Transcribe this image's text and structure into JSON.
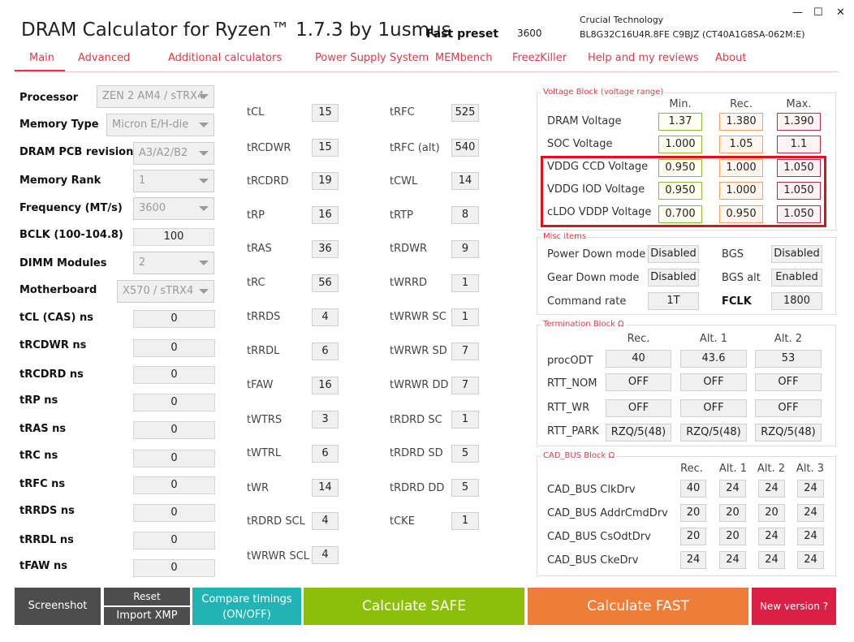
{
  "title": "DRAM Calculator for Ryzen™ 1.7.3 by 1usmus",
  "preset": "Fast preset",
  "frequency_top": "3600",
  "memory": {
    "maker": "Crucial Technology",
    "part": "BL8G32C16U4R.8FE  C9BJZ (CT40A1G8SA-062M:E)"
  },
  "window": {
    "minimize": "—",
    "maximize": "☐",
    "close": "✕"
  },
  "nav": [
    "Main",
    "Advanced",
    "Additional calculators",
    "Power Supply System",
    "MEMbench",
    "FreezKiller",
    "Help and my reviews",
    "About"
  ],
  "left": {
    "processor": {
      "label": "Processor",
      "value": "ZEN 2 AM4 / sTRX4"
    },
    "memory_type": {
      "label": "Memory Type",
      "value": "Micron E/H-die"
    },
    "pcb": {
      "label": "DRAM PCB revision",
      "value": "A3/A2/B2"
    },
    "rank": {
      "label": "Memory Rank",
      "value": "1"
    },
    "frequency": {
      "label": "Frequency (MT/s)",
      "value": "3600"
    },
    "bclk": {
      "label": "BCLK (100-104.8)",
      "value": "100"
    },
    "dimm": {
      "label": "DIMM Modules",
      "value": "2"
    },
    "motherboard": {
      "label": "Motherboard",
      "value": "X570 / sTRX4"
    },
    "ns": [
      {
        "label": "tCL (CAS) ns",
        "value": "0"
      },
      {
        "label": "tRCDWR ns",
        "value": "0"
      },
      {
        "label": "tRCDRD ns",
        "value": "0"
      },
      {
        "label": "tRP ns",
        "value": "0"
      },
      {
        "label": "tRAS ns",
        "value": "0"
      },
      {
        "label": "tRC ns",
        "value": "0"
      },
      {
        "label": "tRFC ns",
        "value": "0"
      },
      {
        "label": "tRRDS ns",
        "value": "0"
      },
      {
        "label": "tRRDL ns",
        "value": "0"
      },
      {
        "label": "tFAW ns",
        "value": "0"
      }
    ]
  },
  "timings_left": [
    {
      "label": "tCL",
      "value": "15"
    },
    {
      "label": "tRCDWR",
      "value": "15"
    },
    {
      "label": "tRCDRD",
      "value": "19"
    },
    {
      "label": "tRP",
      "value": "16"
    },
    {
      "label": "tRAS",
      "value": "36"
    },
    {
      "label": "tRC",
      "value": "56"
    },
    {
      "label": "tRRDS",
      "value": "4"
    },
    {
      "label": "tRRDL",
      "value": "6"
    },
    {
      "label": "tFAW",
      "value": "16"
    },
    {
      "label": "tWTRS",
      "value": "3"
    },
    {
      "label": "tWTRL",
      "value": "6"
    },
    {
      "label": "tWR",
      "value": "14"
    },
    {
      "label": "tRDRD SCL",
      "value": "4"
    },
    {
      "label": "tWRWR SCL",
      "value": "4"
    }
  ],
  "timings_right": [
    {
      "label": "tRFC",
      "value": "525"
    },
    {
      "label": "tRFC (alt)",
      "value": "540"
    },
    {
      "label": "tCWL",
      "value": "14"
    },
    {
      "label": "tRTP",
      "value": "8"
    },
    {
      "label": "tRDWR",
      "value": "9"
    },
    {
      "label": "tWRRD",
      "value": "1"
    },
    {
      "label": "tWRWR SC",
      "value": "1"
    },
    {
      "label": "tWRWR SD",
      "value": "7"
    },
    {
      "label": "tWRWR DD",
      "value": "7"
    },
    {
      "label": "tRDRD SC",
      "value": "1"
    },
    {
      "label": "tRDRD SD",
      "value": "5"
    },
    {
      "label": "tRDRD DD",
      "value": "5"
    },
    {
      "label": "tCKE",
      "value": "1"
    }
  ],
  "voltage": {
    "title": "Voltage Block (voltage range)",
    "headers": [
      "Min.",
      "Rec.",
      "Max."
    ],
    "rows": [
      {
        "label": "DRAM Voltage",
        "min": "1.37",
        "rec": "1.380",
        "max": "1.390"
      },
      {
        "label": "SOC Voltage",
        "min": "1.000",
        "rec": "1.05",
        "max": "1.1"
      },
      {
        "label": "VDDG  CCD Voltage",
        "min": "0.950",
        "rec": "1.000",
        "max": "1.050"
      },
      {
        "label": "VDDG  IOD Voltage",
        "min": "0.950",
        "rec": "1.000",
        "max": "1.050"
      },
      {
        "label": "cLDO VDDP Voltage",
        "min": "0.700",
        "rec": "0.950",
        "max": "1.050"
      }
    ]
  },
  "misc": {
    "title": "Misc items",
    "power_down": {
      "label": "Power Down mode",
      "value": "Disabled"
    },
    "gear_down": {
      "label": "Gear Down mode",
      "value": "Disabled"
    },
    "command_rate": {
      "label": "Command rate",
      "value": "1T"
    },
    "bgs": {
      "label": "BGS",
      "value": "Disabled"
    },
    "bgs_alt": {
      "label": "BGS alt",
      "value": "Enabled"
    },
    "fclk": {
      "label": "FCLK",
      "value": "1800"
    }
  },
  "termination": {
    "title": "Termination Block Ω",
    "headers": [
      "Rec.",
      "Alt. 1",
      "Alt. 2"
    ],
    "rows": [
      {
        "label": "procODT",
        "values": [
          "40",
          "43.6",
          "53"
        ]
      },
      {
        "label": "RTT_NOM",
        "values": [
          "OFF",
          "OFF",
          "OFF"
        ]
      },
      {
        "label": "RTT_WR",
        "values": [
          "OFF",
          "OFF",
          "OFF"
        ]
      },
      {
        "label": "RTT_PARK",
        "values": [
          "RZQ/5(48)",
          "RZQ/5(48)",
          "RZQ/5(48)"
        ]
      }
    ]
  },
  "cadbus": {
    "title": "CAD_BUS Block Ω",
    "headers": [
      "Rec.",
      "Alt. 1",
      "Alt. 2",
      "Alt. 3"
    ],
    "rows": [
      {
        "label": "CAD_BUS ClkDrv",
        "values": [
          "40",
          "24",
          "24",
          "24"
        ]
      },
      {
        "label": "CAD_BUS AddrCmdDrv",
        "values": [
          "20",
          "20",
          "20",
          "24"
        ]
      },
      {
        "label": "CAD_BUS CsOdtDrv",
        "values": [
          "20",
          "20",
          "24",
          "24"
        ]
      },
      {
        "label": "CAD_BUS CkeDrv",
        "values": [
          "24",
          "24",
          "24",
          "24"
        ]
      }
    ]
  },
  "buttons": {
    "screenshot": "Screenshot",
    "reset": "Reset",
    "import_xmp": "Import XMP",
    "compare_line1": "Compare timings",
    "compare_line2": "(ON/OFF)",
    "calc_safe": "Calculate SAFE",
    "calc_fast": "Calculate FAST",
    "new_version": "New version ?"
  },
  "colors": {
    "accent": "#e03a4a",
    "safe": "#8cbf0a",
    "fast": "#ee7d3a",
    "teal": "#22b4b4",
    "dark": "#4d4d4d",
    "red_btn": "#dc1f45"
  }
}
